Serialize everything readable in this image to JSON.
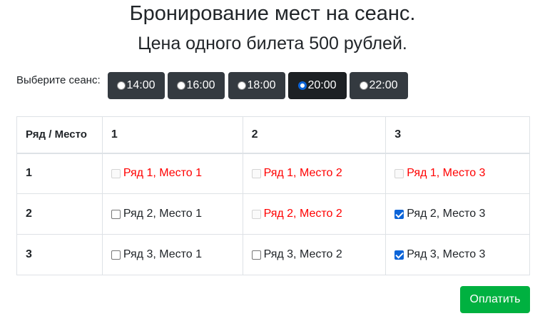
{
  "page": {
    "title": "Бронирование мест на сеанс.",
    "subtitle": "Цена одного билета 500 рублей."
  },
  "sessions": {
    "label": "Выберите сеанс:",
    "options": [
      {
        "time": "14:00",
        "selected": false
      },
      {
        "time": "16:00",
        "selected": false
      },
      {
        "time": "18:00",
        "selected": false
      },
      {
        "time": "20:00",
        "selected": true
      },
      {
        "time": "22:00",
        "selected": false
      }
    ]
  },
  "table": {
    "corner_header": "Ряд / Место",
    "seat_headers": [
      "1",
      "2",
      "3"
    ],
    "rows": [
      {
        "label": "1",
        "seats": [
          {
            "text": "Ряд 1, Место 1",
            "status": "taken",
            "checked": false
          },
          {
            "text": "Ряд 1, Место 2",
            "status": "taken",
            "checked": false
          },
          {
            "text": "Ряд 1, Место 3",
            "status": "taken",
            "checked": false
          }
        ]
      },
      {
        "label": "2",
        "seats": [
          {
            "text": "Ряд 2, Место 1",
            "status": "free",
            "checked": false
          },
          {
            "text": "Ряд 2, Место 2",
            "status": "taken",
            "checked": false
          },
          {
            "text": "Ряд 2, Место 3",
            "status": "free",
            "checked": true
          }
        ]
      },
      {
        "label": "3",
        "seats": [
          {
            "text": "Ряд 3, Место 1",
            "status": "free",
            "checked": false
          },
          {
            "text": "Ряд 3, Место 2",
            "status": "free",
            "checked": false
          },
          {
            "text": "Ряд 3, Место 3",
            "status": "free",
            "checked": true
          }
        ]
      }
    ]
  },
  "actions": {
    "pay_label": "Оплатить"
  },
  "colors": {
    "session_button": "#343a40",
    "taken_text": "#ff0000",
    "pay_button": "#00b140",
    "checkbox_checked": "#0b64d8"
  }
}
